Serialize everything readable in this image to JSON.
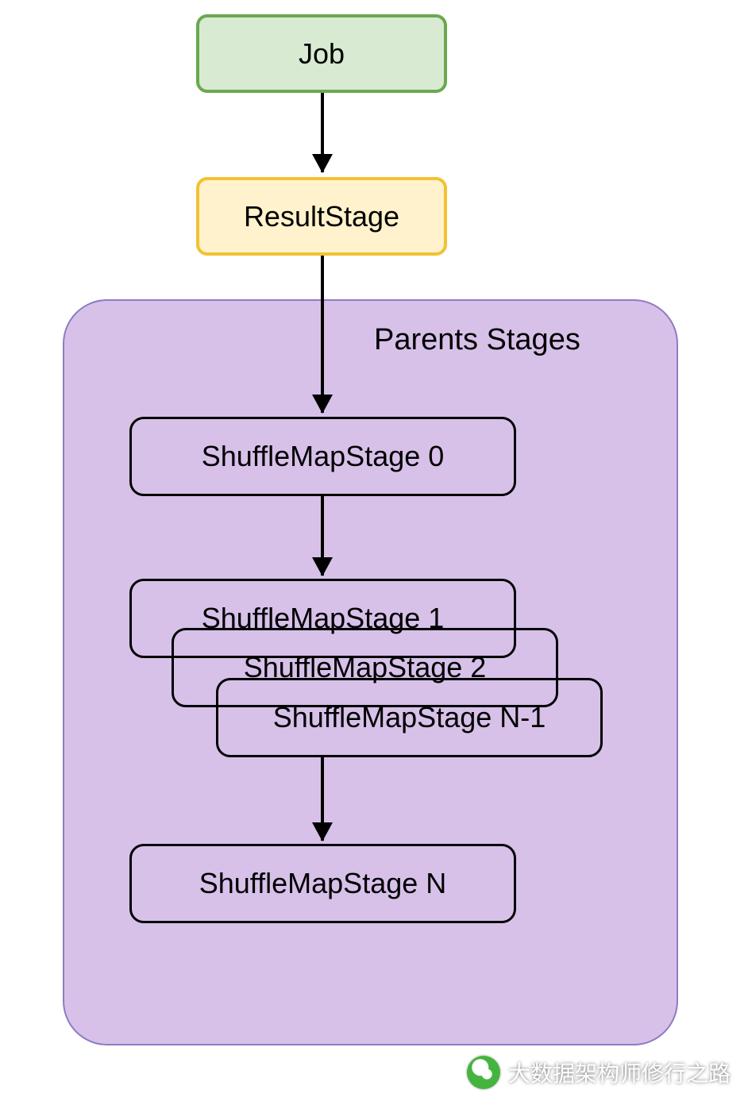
{
  "diagram": {
    "job": "Job",
    "result": "ResultStage",
    "parents_label": "Parents Stages",
    "stages": {
      "s0": "ShuffleMapStage 0",
      "s1": "ShuffleMapStage 1",
      "s2": "ShuffleMapStage 2",
      "sn1": "ShuffleMapStage N-1",
      "sn": "ShuffleMapStage N"
    }
  },
  "watermark": "大数据架构师修行之路",
  "colors": {
    "job_fill": "#d9ead3",
    "job_border": "#6aa84f",
    "result_fill": "#fff2cc",
    "result_border": "#f1c232",
    "parents_fill": "#d7c1e9",
    "parents_border": "#8e7cc3"
  }
}
